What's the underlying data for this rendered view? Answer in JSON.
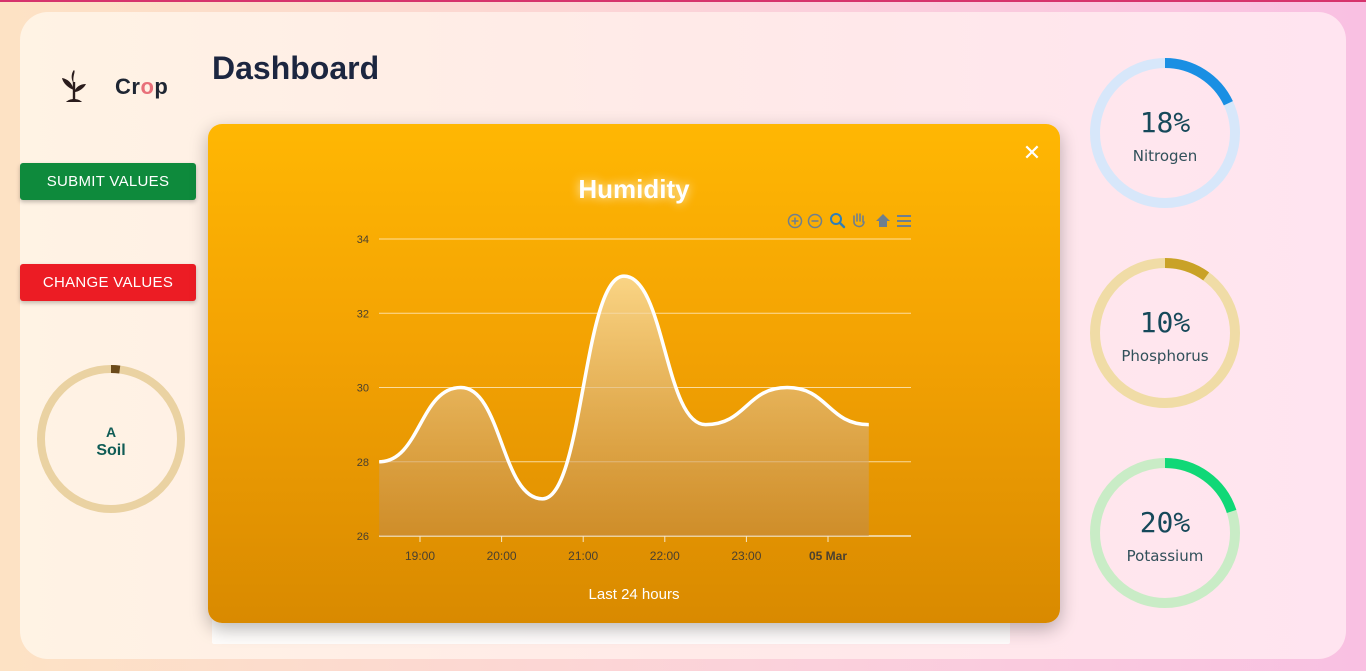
{
  "logo": {
    "text_before": "Cr",
    "text_accent": "o",
    "text_after": "p",
    "icon": "plant-sprout-icon"
  },
  "page_title": "Dashboard",
  "buttons": {
    "submit": "SUBMIT VALUES",
    "change": "CHANGE VALUES"
  },
  "soil": {
    "grade": "A",
    "label": "Soil",
    "level": 0.02
  },
  "nutrients": [
    {
      "value": "18%",
      "label": "Nitrogen",
      "fraction": 0.18,
      "color": "#1a8fe3",
      "track": "#d7e7fa"
    },
    {
      "value": "10%",
      "label": "Phosphorus",
      "fraction": 0.1,
      "color": "#c9a227",
      "track": "#f0dca6"
    },
    {
      "value": "20%",
      "label": "Potassium",
      "fraction": 0.2,
      "color": "#10d877",
      "track": "#c9ecc6"
    }
  ],
  "modal": {
    "title": "Humidity",
    "footer": "Last 24 hours",
    "close_icon": "close-icon",
    "toolbar": [
      "zoom-in-icon",
      "zoom-out-icon",
      "magnify-icon",
      "pan-hand-icon",
      "home-icon",
      "menu-icon"
    ]
  },
  "chart_data": {
    "type": "area",
    "title": "Humidity",
    "xlabel": "Last 24 hours",
    "ylabel": "",
    "x_ticks": [
      "19:00",
      "20:00",
      "21:00",
      "22:00",
      "23:00",
      "05 Mar"
    ],
    "y_ticks": [
      "26",
      "28",
      "30",
      "32",
      "34"
    ],
    "ylim": [
      26,
      34
    ],
    "grid": true,
    "series": [
      {
        "x": [
          "18:30",
          "19:30",
          "20:30",
          "21:30",
          "22:30",
          "23:30",
          "00:30"
        ],
        "values": [
          28,
          30,
          27,
          33,
          29,
          30,
          29
        ]
      }
    ],
    "line_color": "#ffffff"
  }
}
